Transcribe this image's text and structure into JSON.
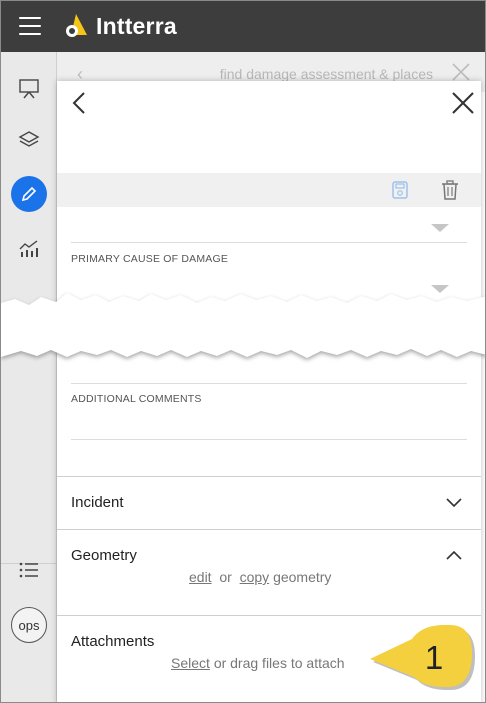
{
  "app": {
    "name": "Intterra"
  },
  "search": {
    "placeholder": "find damage assessment & places"
  },
  "form": {
    "primary_cause_label": "PRIMARY CAUSE OF DAMAGE",
    "additional_comments_label": "ADDITIONAL COMMENTS"
  },
  "sections": {
    "incident": {
      "title": "Incident"
    },
    "geometry": {
      "title": "Geometry",
      "edit_link": "edit",
      "or_text": "or",
      "copy_link": "copy",
      "suffix": "geometry"
    },
    "attachments": {
      "title": "Attachments",
      "select_link": "Select",
      "suffix": "or drag files to attach"
    }
  },
  "sidebar": {
    "ops_label": "ops"
  },
  "callout": {
    "number": "1"
  },
  "colors": {
    "topbar": "#3d3d3d",
    "active": "#1a73e8",
    "logo": "#f5c518",
    "callout": "#f4d03f"
  }
}
